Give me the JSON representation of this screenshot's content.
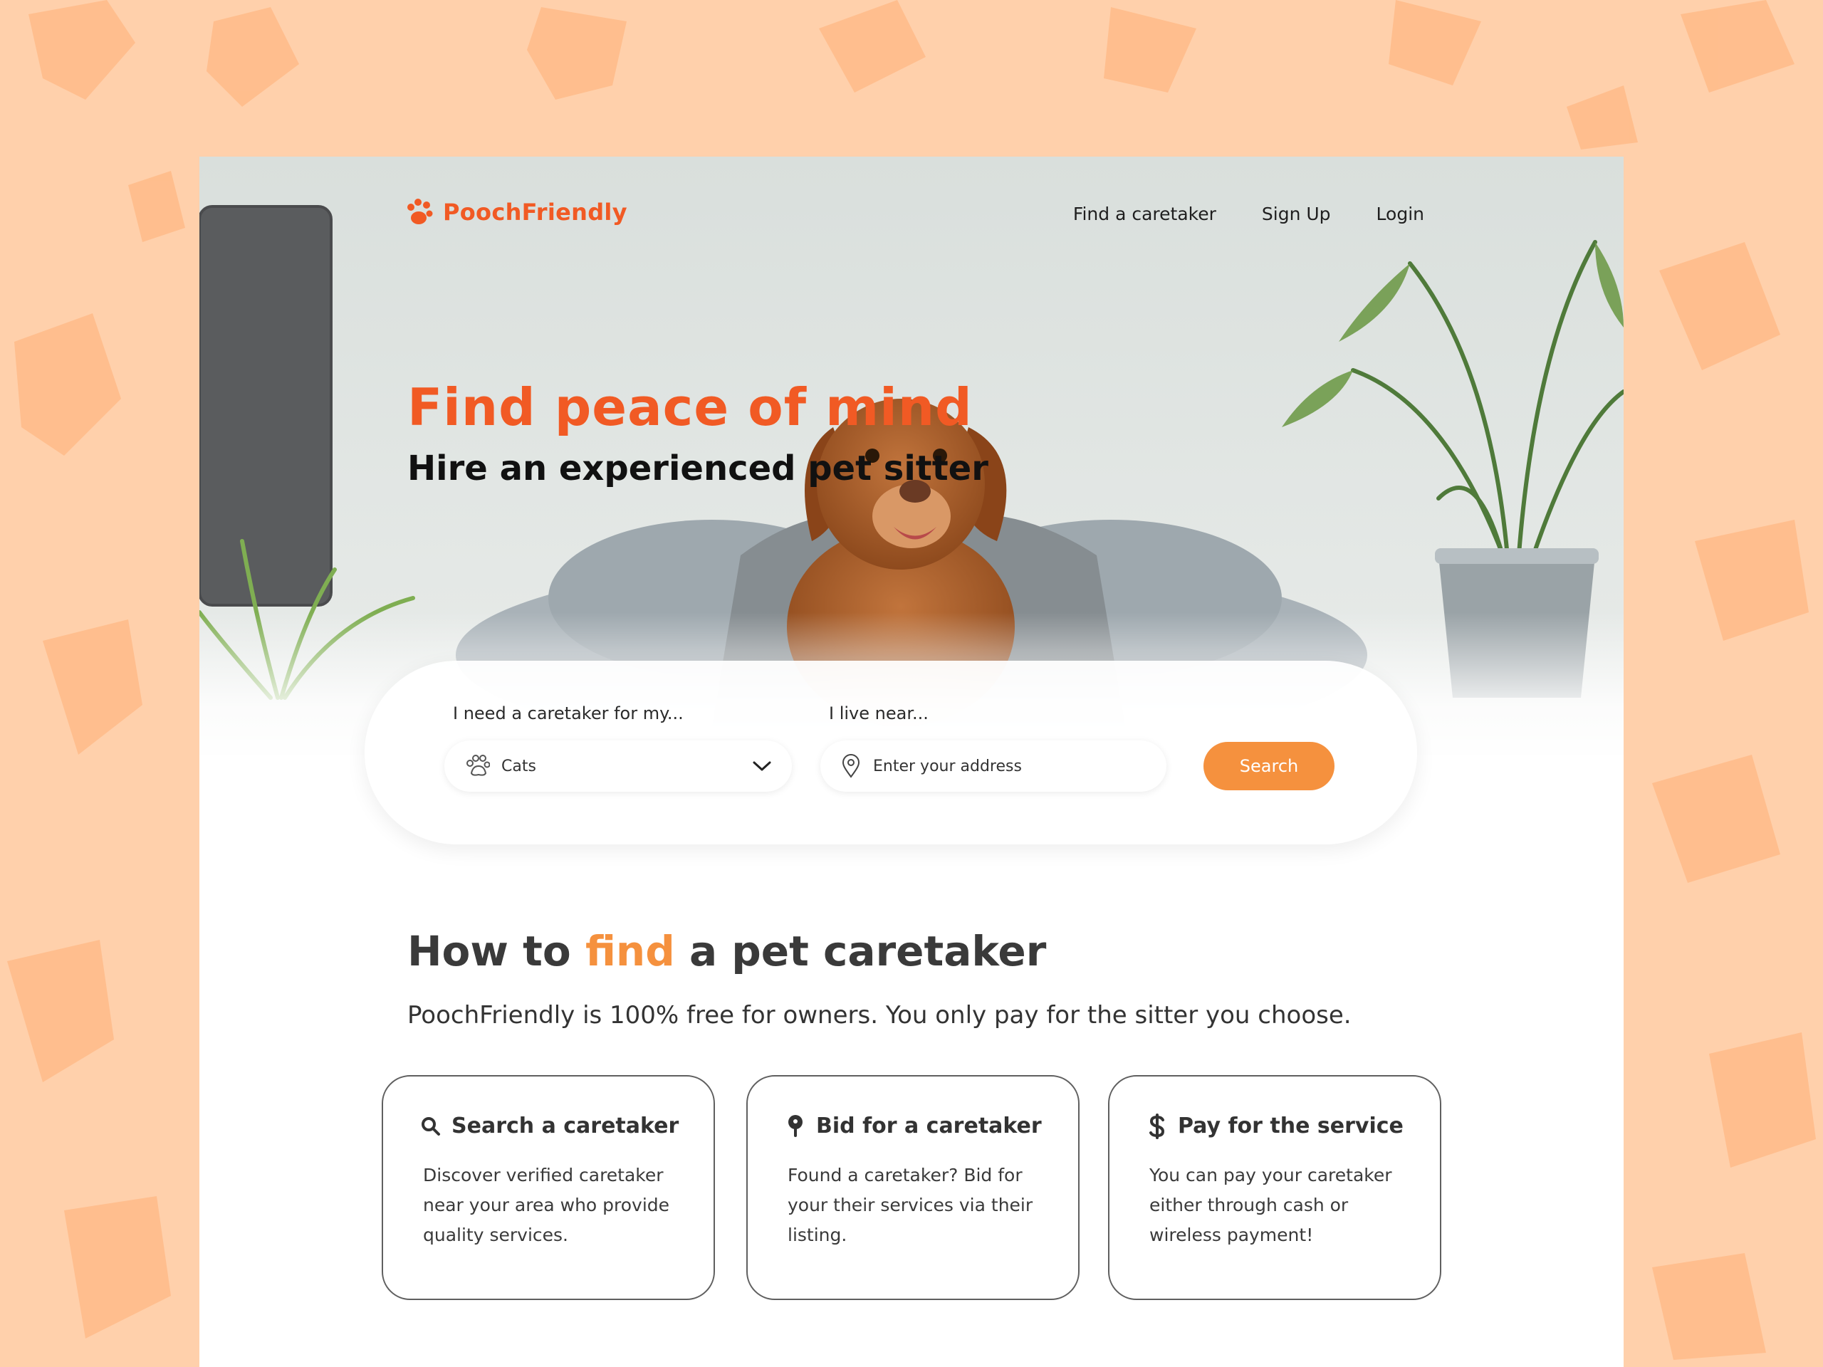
{
  "brand": {
    "name": "PoochFriendly",
    "logo_icon": "paw-icon",
    "accent": "#f15a24",
    "accent_secondary": "#f5913e",
    "backdrop": "#ffd0ab"
  },
  "nav": {
    "links": [
      {
        "label": "Find a caretaker"
      },
      {
        "label": "Sign Up"
      },
      {
        "label": "Login"
      }
    ]
  },
  "hero": {
    "title": "Find peace of mind",
    "subtitle": "Hire an experienced pet sitter"
  },
  "search": {
    "pet_label": "I need a caretaker for my...",
    "pet_value": "Cats",
    "pet_icon": "paw-outline-icon",
    "location_label": "I live near...",
    "location_placeholder": "Enter your address",
    "location_icon": "map-pin-icon",
    "button_label": "Search"
  },
  "how": {
    "title_before": "How to ",
    "title_accent": "find",
    "title_after": " a pet caretaker",
    "description": "PoochFriendly is 100% free for owners. You only pay for the sitter you choose.",
    "steps": [
      {
        "icon": "search-icon",
        "title": "Search a caretaker",
        "text": "Discover verified caretaker near your area who provide quality services."
      },
      {
        "icon": "bid-icon",
        "title": "Bid for a caretaker",
        "text": "Found a caretaker? Bid for your their services via their listing."
      },
      {
        "icon": "dollar-icon",
        "title": "Pay for the service",
        "text": "You can pay your caretaker either through cash or wireless payment!"
      }
    ]
  }
}
